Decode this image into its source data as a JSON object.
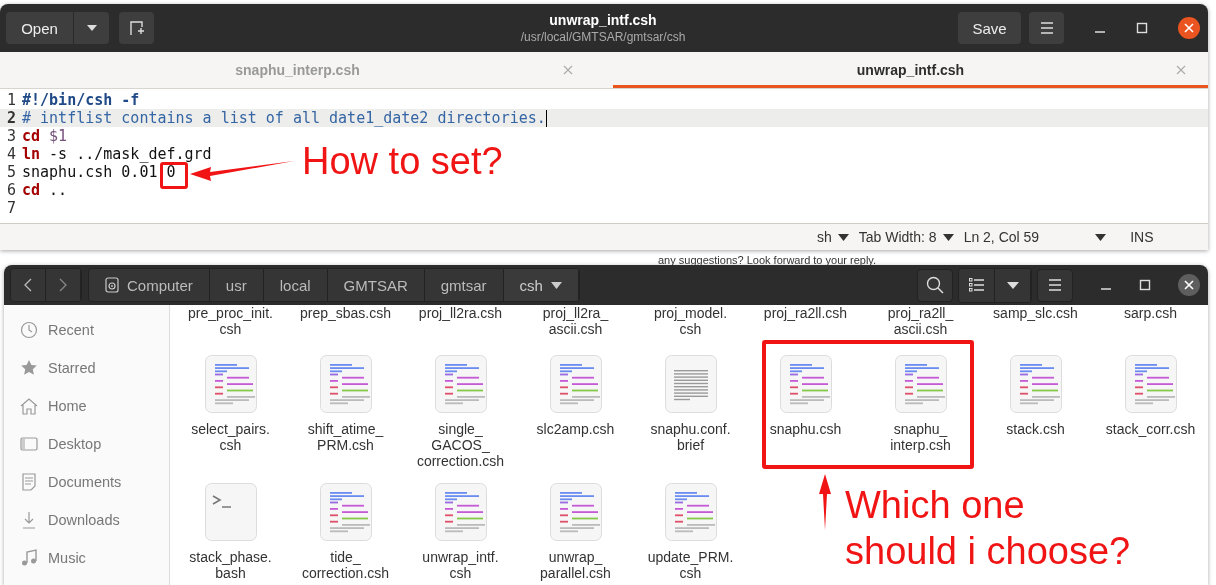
{
  "editor": {
    "open_button": "Open",
    "title": "unwrap_intf.csh",
    "subtitle": "/usr/local/GMTSAR/gmtsar/csh",
    "save_button": "Save",
    "tabs": [
      {
        "label": "snaphu_interp.csh",
        "selected": false
      },
      {
        "label": "unwrap_intf.csh",
        "selected": true
      }
    ],
    "lines": [
      {
        "number": "1",
        "current": false,
        "tokens": [
          {
            "text": "#!/bin/csh -f",
            "kind": "shebang"
          }
        ]
      },
      {
        "number": "2",
        "current": true,
        "tokens": [
          {
            "text": "# intflist contains a list of all date1_date2 directories.",
            "kind": "comment"
          }
        ]
      },
      {
        "number": "3",
        "current": false,
        "tokens": [
          {
            "text": "cd",
            "kind": "keyword"
          },
          {
            "text": " $1",
            "kind": "variable"
          }
        ]
      },
      {
        "number": "4",
        "current": false,
        "tokens": [
          {
            "text": "ln",
            "kind": "keyword"
          },
          {
            "text": " -s ../mask_def.grd",
            "kind": "plain"
          }
        ]
      },
      {
        "number": "5",
        "current": false,
        "tokens": [
          {
            "text": "snaphu.csh 0.01 0",
            "kind": "plain"
          }
        ]
      },
      {
        "number": "6",
        "current": false,
        "tokens": [
          {
            "text": "cd",
            "kind": "keyword"
          },
          {
            "text": " ..",
            "kind": "plain"
          }
        ]
      },
      {
        "number": "7",
        "current": false
      }
    ],
    "status_bar": {
      "language": "sh",
      "tab_width": "Tab Width: 8",
      "position": "Ln 2, Col 59",
      "mode": "INS"
    }
  },
  "background_text": "any suggestions? Look forward to your reply.",
  "files_window": {
    "path": [
      {
        "label": "Computer",
        "kind": "drive",
        "selected": false
      },
      {
        "label": "usr",
        "kind": "folder",
        "selected": false
      },
      {
        "label": "local",
        "kind": "folder",
        "selected": false
      },
      {
        "label": "GMTSAR",
        "kind": "folder",
        "selected": false
      },
      {
        "label": "gmtsar",
        "kind": "folder",
        "selected": false
      },
      {
        "label": "csh",
        "kind": "folder",
        "selected": true
      }
    ],
    "sidebar": [
      {
        "label": "Recent",
        "kind": "recent"
      },
      {
        "label": "Starred",
        "kind": "starred"
      },
      {
        "label": "Home",
        "kind": "home"
      },
      {
        "label": "Desktop",
        "kind": "desktop"
      },
      {
        "label": "Documents",
        "kind": "documents"
      },
      {
        "label": "Downloads",
        "kind": "downloads"
      },
      {
        "label": "Music",
        "kind": "music"
      }
    ],
    "rows": [
      {
        "icons_shown": false,
        "files": [
          {
            "name": "pre_proc_init.\ncsh"
          },
          {
            "name": "prep_sbas.csh"
          },
          {
            "name": "proj_ll2ra.csh"
          },
          {
            "name": "proj_ll2ra_\nascii.csh"
          },
          {
            "name": "proj_model.\ncsh"
          },
          {
            "name": "proj_ra2ll.csh"
          },
          {
            "name": "proj_ra2ll_\nascii.csh"
          },
          {
            "name": "samp_slc.csh"
          },
          {
            "name": "sarp.csh"
          }
        ]
      },
      {
        "icons_shown": true,
        "files": [
          {
            "name": "select_pairs.\ncsh",
            "kind": "script"
          },
          {
            "name": "shift_atime_\nPRM.csh",
            "kind": "script"
          },
          {
            "name": "single_\nGACOS_\ncorrection.csh",
            "kind": "script"
          },
          {
            "name": "slc2amp.csh",
            "kind": "script"
          },
          {
            "name": "snaphu.conf.\nbrief",
            "kind": "text"
          },
          {
            "name": "snaphu.csh",
            "kind": "script"
          },
          {
            "name": "snaphu_\ninterp.csh",
            "kind": "script"
          },
          {
            "name": "stack.csh",
            "kind": "script"
          },
          {
            "name": "stack_corr.csh",
            "kind": "script"
          }
        ]
      },
      {
        "icons_shown": true,
        "files": [
          {
            "name": "stack_phase.\nbash",
            "kind": "terminal"
          },
          {
            "name": "tide_\ncorrection.csh",
            "kind": "script"
          },
          {
            "name": "unwrap_intf.\ncsh",
            "kind": "script"
          },
          {
            "name": "unwrap_\nparallel.csh",
            "kind": "script"
          },
          {
            "name": "update_PRM.\ncsh",
            "kind": "script"
          }
        ]
      }
    ]
  },
  "annotations": [
    {
      "kind": "callout",
      "text": "How to set?"
    },
    {
      "kind": "question",
      "text": "Which one\nshould i choose?"
    }
  ]
}
